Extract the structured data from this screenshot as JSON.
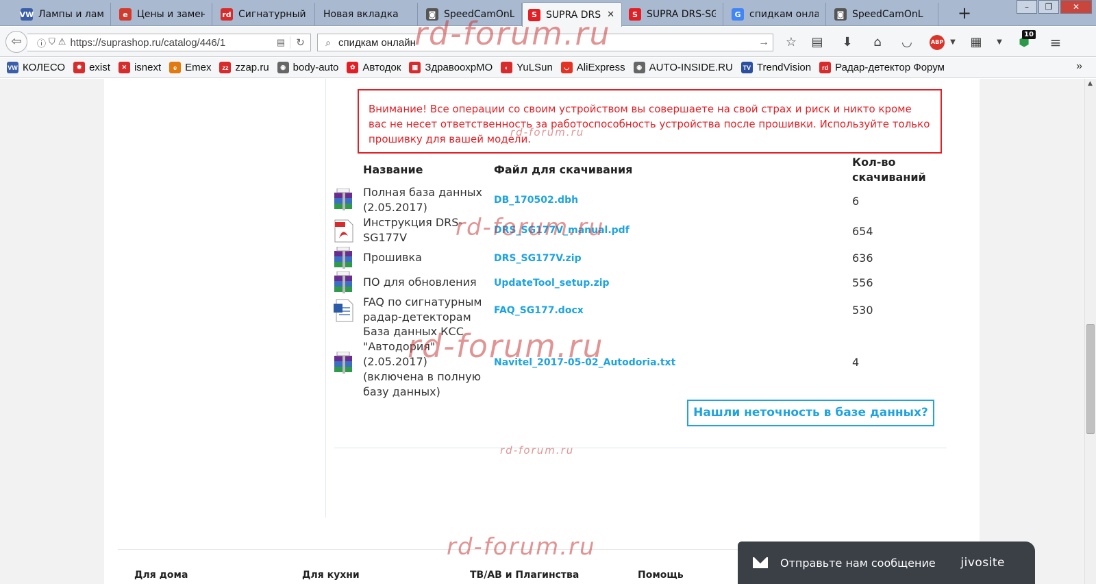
{
  "browser": {
    "tabs": [
      {
        "label": "Лампы и ламп",
        "favicon": "vw-icon",
        "color": "#3a5ea8",
        "glyph": "VW"
      },
      {
        "label": "Цены и замен",
        "favicon": "e-icon",
        "color": "#d23a2c",
        "glyph": "e"
      },
      {
        "label": "Сигнатурный р",
        "favicon": "rd-icon",
        "color": "#d82c2c",
        "glyph": "rd"
      },
      {
        "label": "Новая вкладка",
        "favicon": "",
        "color": "",
        "glyph": ""
      },
      {
        "label": "SpeedCamOnL",
        "favicon": "camera-icon",
        "color": "#555555",
        "glyph": "◙"
      },
      {
        "label": "SUPRA DRS",
        "favicon": "supra-icon",
        "color": "#e31e24",
        "glyph": "S",
        "active": true
      },
      {
        "label": "SUPRA DRS-SG",
        "favicon": "supra-icon",
        "color": "#e31e24",
        "glyph": "S"
      },
      {
        "label": "спидкам онла",
        "favicon": "google-icon",
        "color": "#4285f4",
        "glyph": "G"
      },
      {
        "label": "SpeedCamOnL",
        "favicon": "camera-icon",
        "color": "#555555",
        "glyph": "◙"
      }
    ],
    "new_tab": "+",
    "url": "https://suprashop.ru/catalog/446/1",
    "search_value": "спидкам онлайн",
    "extension_badge": "10",
    "abp_label": "ABP",
    "bookmarks": [
      {
        "label": "КОЛЕСО",
        "icon": "vw-icon",
        "color": "#3a5ea8",
        "glyph": "VW"
      },
      {
        "label": "exist",
        "icon": "exist-icon",
        "color": "#d82c2c",
        "glyph": "✹"
      },
      {
        "label": "isnext",
        "icon": "isnext-icon",
        "color": "#d82c2c",
        "glyph": "✕"
      },
      {
        "label": "Emex",
        "icon": "emex-icon",
        "color": "#e27a10",
        "glyph": "e"
      },
      {
        "label": "zzap.ru",
        "icon": "zzap-icon",
        "color": "#d82c2c",
        "glyph": "zz"
      },
      {
        "label": "body-auto",
        "icon": "globe-icon",
        "color": "#666666",
        "glyph": "◉"
      },
      {
        "label": "Автодок",
        "icon": "avtodok-icon",
        "color": "#e31e24",
        "glyph": "✿"
      },
      {
        "label": "ЗдравоохрМО",
        "icon": "zdrav-icon",
        "color": "#d82c2c",
        "glyph": "▦"
      },
      {
        "label": "YuLSun",
        "icon": "yulsun-icon",
        "color": "#d82c2c",
        "glyph": "◐"
      },
      {
        "label": "AliExpress",
        "icon": "aliexpress-icon",
        "color": "#e43225",
        "glyph": "◡"
      },
      {
        "label": "AUTO-INSIDE.RU",
        "icon": "globe-icon",
        "color": "#666666",
        "glyph": "◉"
      },
      {
        "label": "TrendVision",
        "icon": "trendvision-icon",
        "color": "#2a4ea0",
        "glyph": "TV"
      },
      {
        "label": "Радар-детектор Форум",
        "icon": "rd-icon",
        "color": "#d82c2c",
        "glyph": "rd"
      }
    ]
  },
  "page": {
    "warning": "Внимание! Все операции со своим устройством вы совершаете на свой страх и риск и никто кроме вас не несет ответственность за работоспособность устройства после прошивки. Используйте только прошивку для вашей модели.",
    "table": {
      "headers": {
        "name": "Название",
        "file": "Файл для скачивания",
        "count": "Кол-во скачиваний"
      },
      "rows": [
        {
          "name": "Полная база данных (2.05.2017)",
          "file": "DB_170502.dbh",
          "count": "6",
          "icon": "rar-icon"
        },
        {
          "name": "Инструкция DRS-SG177V",
          "file": "DRS_SG177V_manual.pdf",
          "count": "654",
          "icon": "pdf-icon"
        },
        {
          "name": "Прошивка",
          "file": "DRS_SG177V.zip",
          "count": "636",
          "icon": "rar-icon"
        },
        {
          "name": "ПО для обновления",
          "file": "UpdateTool_setup.zip",
          "count": "556",
          "icon": "rar-icon"
        },
        {
          "name": "FAQ по сигнатурным радар-детекторам",
          "file": "FAQ_SG177.docx",
          "count": "530",
          "icon": "doc-icon"
        },
        {
          "name": "База данных КСС \"Автодория\" (2.05.2017) (включена в полную базу данных)",
          "file": "Navitel_2017-05-02_Autodoria.txt",
          "count": "4",
          "icon": "rar-icon"
        }
      ]
    },
    "report_button": "Нашли неточность в базе данных?",
    "footer_cols": [
      "Для дома",
      "Для кухни",
      "ТВ/АВ и Плагинства",
      "Помощь"
    ]
  },
  "watermark": "rd-forum.ru",
  "chat": {
    "label": "Отправьте нам сообщение",
    "brand": "jivosite"
  },
  "colors": {
    "accent": "#1ea3e0",
    "warning": "#e31e24"
  }
}
